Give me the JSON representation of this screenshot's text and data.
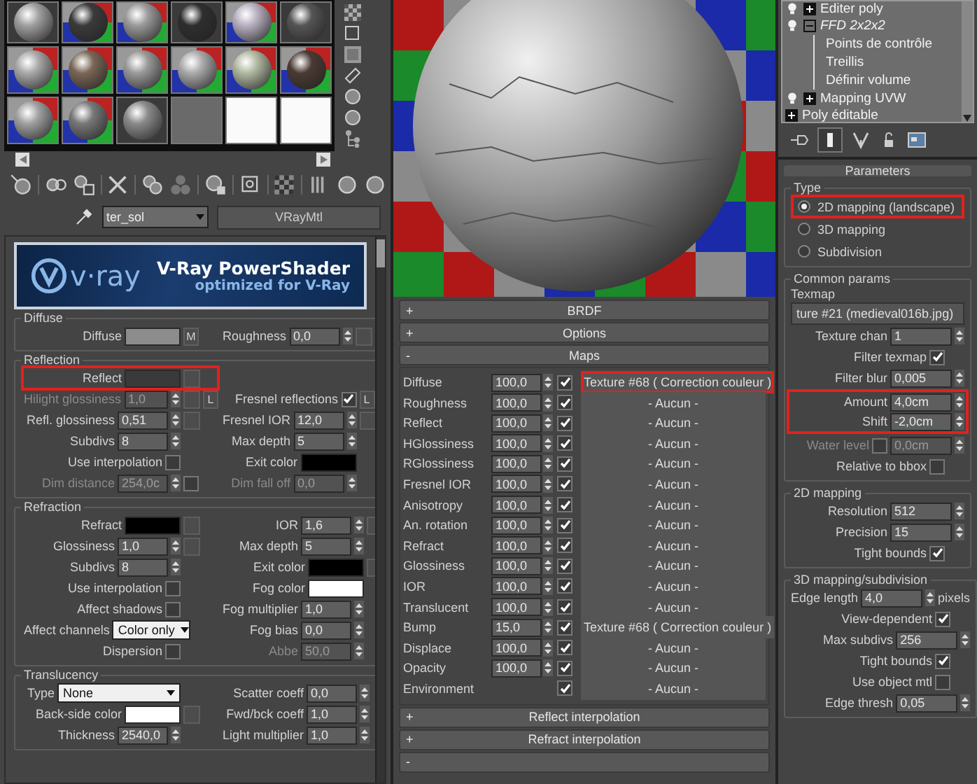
{
  "material": {
    "name": "ter_sol",
    "type": "VRayMtl"
  },
  "banner": {
    "logo": "v·ray",
    "title": "V-Ray PowerShader",
    "subtitle": "optimized for V-Ray"
  },
  "sections": [
    {
      "title": "Diffuse",
      "rows": [
        {
          "left": {
            "kind": "color",
            "label": "Diffuse",
            "color": "#8c8c8c",
            "map_button": false,
            "button": "M",
            "highlighted": false
          },
          "right": {
            "kind": "spinner",
            "label": "Roughness",
            "value": "0,0",
            "disabled": false,
            "map_button": true,
            "highlighted": false
          }
        }
      ]
    },
    {
      "title": "Reflection",
      "rows": [
        {
          "left": {
            "kind": "color",
            "label": "Reflect",
            "color": "#3a3a3a",
            "map_button": true,
            "highlighted": true
          }
        },
        {
          "left": {
            "kind": "spinner",
            "label": "Hilight glossiness",
            "value": "1,0",
            "disabled": true,
            "map_button": true,
            "button": "L",
            "highlighted": false
          },
          "right": {
            "kind": "check",
            "label": "Fresnel reflections",
            "checked": true,
            "button": "L",
            "highlighted": false
          }
        },
        {
          "left": {
            "kind": "spinner",
            "label": "Refl. glossiness",
            "value": "0,51",
            "disabled": false,
            "map_button": true,
            "highlighted": false
          },
          "right": {
            "kind": "spinner",
            "label": "Fresnel IOR",
            "value": "12,0",
            "disabled": false,
            "map_button": true,
            "highlighted": false
          }
        },
        {
          "left": {
            "kind": "spinner",
            "label": "Subdivs",
            "value": "8",
            "disabled": false,
            "map_button": false,
            "highlighted": false
          },
          "right": {
            "kind": "spinner",
            "label": "Max depth",
            "value": "5",
            "disabled": false,
            "map_button": false,
            "highlighted": false
          }
        },
        {
          "left": {
            "kind": "check",
            "label": "Use interpolation",
            "checked": false,
            "highlighted": false
          },
          "right": {
            "kind": "color",
            "label": "Exit color",
            "color": "#000000",
            "map_button": false,
            "highlighted": false
          }
        },
        {
          "left": {
            "kind": "spinner",
            "label": "Dim distance",
            "value": "254,0c",
            "disabled": true,
            "checked": false,
            "map_button": false,
            "highlighted": false
          },
          "right": {
            "kind": "spinner",
            "label": "Dim fall off",
            "value": "0,0",
            "disabled": true,
            "map_button": false,
            "highlighted": false
          }
        }
      ]
    },
    {
      "title": "Refraction",
      "rows": [
        {
          "left": {
            "kind": "color",
            "label": "Refract",
            "color": "#000000",
            "map_button": true,
            "highlighted": false
          },
          "right": {
            "kind": "spinner",
            "label": "IOR",
            "value": "1,6",
            "disabled": false,
            "map_button": true,
            "highlighted": false
          }
        },
        {
          "left": {
            "kind": "spinner",
            "label": "Glossiness",
            "value": "1,0",
            "disabled": false,
            "map_button": true,
            "highlighted": false
          },
          "right": {
            "kind": "spinner",
            "label": "Max depth",
            "value": "5",
            "disabled": false,
            "map_button": false,
            "highlighted": false
          }
        },
        {
          "left": {
            "kind": "spinner",
            "label": "Subdivs",
            "value": "8",
            "disabled": false,
            "map_button": false,
            "highlighted": false
          },
          "right": {
            "kind": "color",
            "label": "Exit color",
            "color": "#000000",
            "map_button": true,
            "highlighted": false
          }
        },
        {
          "left": {
            "kind": "check",
            "label": "Use interpolation",
            "checked": false,
            "highlighted": false
          },
          "right": {
            "kind": "color",
            "label": "Fog color",
            "color": "#ffffff",
            "map_button": false,
            "highlighted": false
          }
        },
        {
          "left": {
            "kind": "check",
            "label": "Affect shadows",
            "checked": false,
            "highlighted": false
          },
          "right": {
            "kind": "spinner",
            "label": "Fog multiplier",
            "value": "1,0",
            "disabled": false,
            "map_button": false,
            "highlighted": false
          }
        },
        {
          "left": {
            "kind": "dropdown",
            "label": "Affect channels",
            "value": "Color only",
            "highlighted": false
          },
          "right": {
            "kind": "spinner",
            "label": "Fog bias",
            "value": "0,0",
            "disabled": false,
            "map_button": false,
            "highlighted": false
          }
        },
        {
          "left": {
            "kind": "check",
            "label": "Dispersion",
            "checked": false,
            "highlighted": false
          },
          "right": {
            "kind": "spinner",
            "label": "Abbe",
            "value": "50,0",
            "disabled": true,
            "map_button": false,
            "highlighted": false
          }
        }
      ]
    },
    {
      "title": "Translucency",
      "rows": [
        {
          "left": {
            "kind": "dropdown",
            "label": "Type",
            "value": "None",
            "highlighted": false
          },
          "right": {
            "kind": "spinner",
            "label": "Scatter coeff",
            "value": "0,0",
            "disabled": false,
            "map_button": false,
            "highlighted": false
          }
        },
        {
          "left": {
            "kind": "color",
            "label": "Back-side color",
            "color": "#ffffff",
            "map_button": true,
            "highlighted": false
          },
          "right": {
            "kind": "spinner",
            "label": "Fwd/bck coeff",
            "value": "1,0",
            "disabled": false,
            "map_button": false,
            "highlighted": false
          }
        },
        {
          "left": {
            "kind": "spinner",
            "label": "Thickness",
            "value": "2540,0",
            "disabled": false,
            "map_button": false,
            "highlighted": false
          },
          "right": {
            "kind": "spinner",
            "label": "Light multiplier",
            "value": "1,0",
            "disabled": false,
            "map_button": false,
            "highlighted": false
          }
        }
      ]
    }
  ],
  "rollouts_top": [
    {
      "sign": "+",
      "title": "BRDF"
    },
    {
      "sign": "+",
      "title": "Options"
    }
  ],
  "maps": {
    "sign": "-",
    "title": "Maps",
    "rows": [
      {
        "label": "Diffuse",
        "amount": "100,0",
        "enabled": true,
        "map": "Texture #68  ( Correction couleur )",
        "highlighted": true
      },
      {
        "label": "Roughness",
        "amount": "100,0",
        "enabled": true,
        "map": "- Aucun -",
        "highlighted": false
      },
      {
        "label": "Reflect",
        "amount": "100,0",
        "enabled": true,
        "map": "- Aucun -",
        "highlighted": false
      },
      {
        "label": "HGlossiness",
        "amount": "100,0",
        "enabled": true,
        "map": "- Aucun -",
        "highlighted": false
      },
      {
        "label": "RGlossiness",
        "amount": "100,0",
        "enabled": true,
        "map": "- Aucun -",
        "highlighted": false
      },
      {
        "label": "Fresnel IOR",
        "amount": "100,0",
        "enabled": true,
        "map": "- Aucun -",
        "highlighted": false
      },
      {
        "label": "Anisotropy",
        "amount": "100,0",
        "enabled": true,
        "map": "- Aucun -",
        "highlighted": false
      },
      {
        "label": "An. rotation",
        "amount": "100,0",
        "enabled": true,
        "map": "- Aucun -",
        "highlighted": false
      },
      {
        "label": "Refract",
        "amount": "100,0",
        "enabled": true,
        "map": "- Aucun -",
        "highlighted": false
      },
      {
        "label": "Glossiness",
        "amount": "100,0",
        "enabled": true,
        "map": "- Aucun -",
        "highlighted": false
      },
      {
        "label": "IOR",
        "amount": "100,0",
        "enabled": true,
        "map": "- Aucun -",
        "highlighted": false
      },
      {
        "label": "Translucent",
        "amount": "100,0",
        "enabled": true,
        "map": "- Aucun -",
        "highlighted": false
      },
      {
        "label": "Bump",
        "amount": "15,0",
        "enabled": true,
        "map": "Texture #68  ( Correction couleur )",
        "highlighted": false
      },
      {
        "label": "Displace",
        "amount": "100,0",
        "enabled": true,
        "map": "- Aucun -",
        "highlighted": false
      },
      {
        "label": "Opacity",
        "amount": "100,0",
        "enabled": true,
        "map": "- Aucun -",
        "highlighted": false
      },
      {
        "label": "Environment",
        "enabled": true,
        "map": "- Aucun -",
        "highlighted": false
      }
    ]
  },
  "rollouts_bottom": [
    {
      "sign": "+",
      "title": "Reflect interpolation"
    },
    {
      "sign": "+",
      "title": "Refract interpolation"
    },
    {
      "sign": "-"
    }
  ],
  "modifier_stack": [
    {
      "kind": "modifier",
      "label": "Editer poly",
      "expanded": false,
      "viewport_disabled": false
    },
    {
      "kind": "modifier",
      "label": "FFD 2x2x2",
      "expanded": true,
      "viewport_disabled": true,
      "children": [
        {
          "label": "Points de contrôle"
        },
        {
          "label": "Treillis"
        },
        {
          "label": "Définir volume"
        }
      ]
    },
    {
      "kind": "modifier",
      "label": "Mapping UVW",
      "expanded": false,
      "viewport_disabled": false
    },
    {
      "kind": "object",
      "label": "Poly éditable",
      "expanded": false,
      "viewport_disabled": false
    }
  ],
  "parameters": {
    "title": "Parameters"
  },
  "type_group": {
    "title": "Type",
    "options": [
      {
        "label": "2D mapping (landscape)",
        "selected": true,
        "highlighted": true
      },
      {
        "label": "3D mapping",
        "selected": false,
        "highlighted": false
      },
      {
        "label": "Subdivision",
        "selected": false,
        "highlighted": false
      }
    ]
  },
  "common_params": {
    "title": "Common params",
    "texmap_label": "Texmap",
    "texmap": "ture #21 (medieval016b.jpg)",
    "rows": [
      {
        "kind": "spinner",
        "label": "Texture chan",
        "value": "1",
        "disabled": false,
        "highlighted": false
      },
      {
        "kind": "check",
        "label": "Filter texmap",
        "checked": true,
        "highlighted": false
      },
      {
        "kind": "spinner",
        "label": "Filter blur",
        "value": "0,005",
        "disabled": false,
        "highlighted": false
      },
      {
        "kind": "spinner",
        "label": "Amount",
        "value": "4,0cm",
        "disabled": false,
        "highlighted": true
      },
      {
        "kind": "spinner",
        "label": "Shift",
        "value": "-2,0cm",
        "disabled": false,
        "highlighted": true
      },
      {
        "kind": "spinner",
        "label": "Water level",
        "value": "0,0cm",
        "disabled": true,
        "checked": false,
        "highlighted": false
      },
      {
        "kind": "check",
        "label": "Relative to bbox",
        "checked": false,
        "highlighted": false
      }
    ]
  },
  "mapping_2d": {
    "title": "2D mapping",
    "rows": [
      {
        "kind": "spinner",
        "label": "Resolution",
        "value": "512",
        "disabled": false,
        "highlighted": false
      },
      {
        "kind": "spinner",
        "label": "Precision",
        "value": "15",
        "disabled": false,
        "highlighted": false
      },
      {
        "kind": "check",
        "label": "Tight bounds",
        "checked": true,
        "highlighted": false
      }
    ]
  },
  "mapping_3d": {
    "title": "3D mapping/subdivision",
    "rows": [
      {
        "kind": "spinner",
        "label": "Edge length",
        "value": "4,0",
        "unit": "pixels",
        "disabled": false,
        "highlighted": false
      },
      {
        "kind": "check",
        "label": "View-dependent",
        "checked": true,
        "highlighted": false
      },
      {
        "kind": "spinner",
        "label": "Max subdivs",
        "value": "256",
        "disabled": false,
        "highlighted": false
      },
      {
        "kind": "check",
        "label": "Tight bounds",
        "checked": true,
        "highlighted": false
      },
      {
        "kind": "check",
        "label": "Use object mtl",
        "checked": false,
        "highlighted": false
      },
      {
        "kind": "spinner",
        "label": "Edge thresh",
        "value": "0,05",
        "disabled": false,
        "highlighted": false
      }
    ]
  }
}
